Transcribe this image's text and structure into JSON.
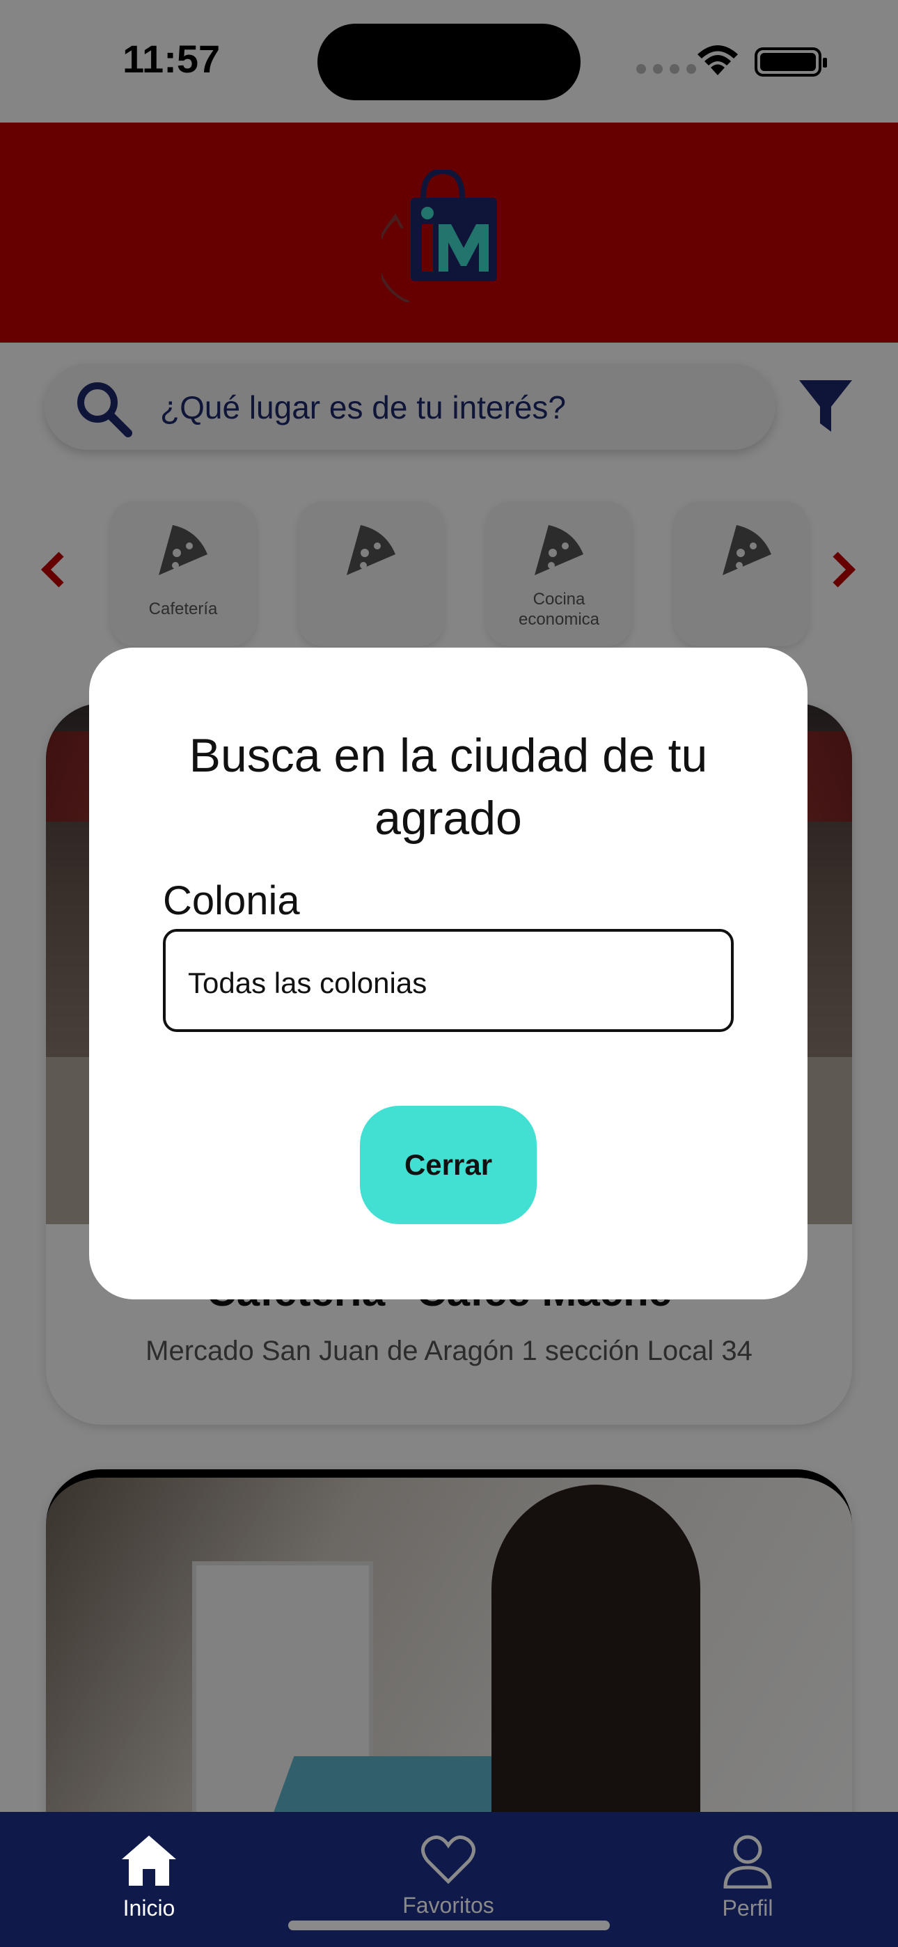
{
  "status_bar": {
    "time": "11:57"
  },
  "brand": {
    "logo_text": "iM",
    "primary_color": "#c40000",
    "accent_color": "#41e0d2",
    "navy_color": "#1e2a6e"
  },
  "search": {
    "placeholder": "¿Qué lugar es de tu interés?"
  },
  "categories": [
    {
      "label": "Cafetería",
      "icon": "pizza-icon"
    },
    {
      "label": "",
      "icon": "pizza-icon"
    },
    {
      "label": "Cocina economica",
      "icon": "pizza-icon"
    },
    {
      "label": "",
      "icon": "pizza-icon"
    }
  ],
  "listings": [
    {
      "title": "Cafetería \"Cafee Mache\"",
      "address": "Mercado San Juan de Aragón 1 sección Local 34"
    },
    {
      "title": "",
      "address": ""
    }
  ],
  "modal": {
    "title": "Busca en la ciudad de tu agrado",
    "field_label": "Colonia",
    "field_value": "Todas las colonias",
    "close_label": "Cerrar"
  },
  "tab_bar": {
    "items": [
      {
        "label": "Inicio",
        "icon": "home-icon",
        "active": true
      },
      {
        "label": "Favoritos",
        "icon": "heart-icon",
        "active": false
      },
      {
        "label": "Perfil",
        "icon": "user-icon",
        "active": false
      }
    ]
  }
}
